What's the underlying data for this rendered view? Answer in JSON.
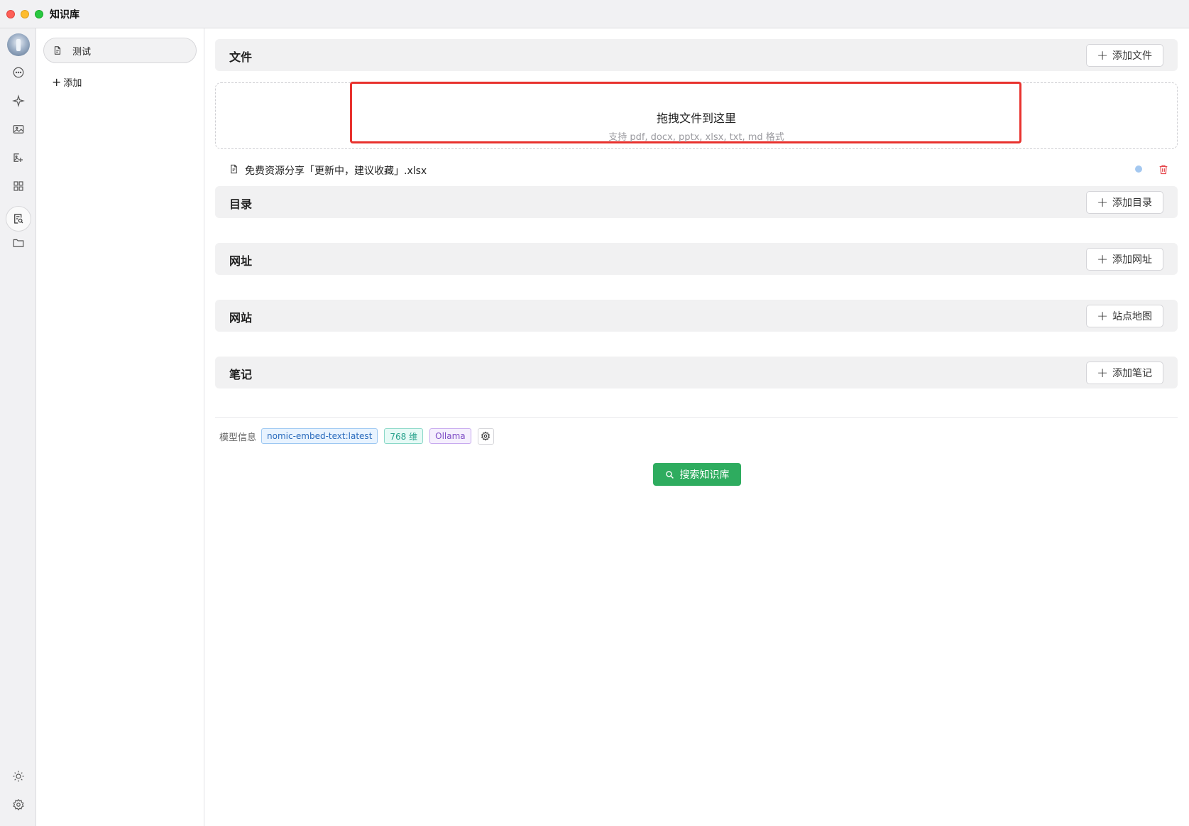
{
  "window": {
    "title": "知识库"
  },
  "rail": {
    "icons": [
      "avatar",
      "chat-icon",
      "sparkle-icon",
      "image-icon",
      "image-edit-icon",
      "apps-grid-icon",
      "knowledge-base-icon",
      "folder-icon",
      "sun-icon",
      "settings-icon"
    ],
    "active": "knowledge-base-icon"
  },
  "kb_list": {
    "items": [
      {
        "label": "测试"
      }
    ],
    "add_label": "添加"
  },
  "sections": {
    "files": {
      "title": "文件",
      "button": "添加文件"
    },
    "directory": {
      "title": "目录",
      "button": "添加目录"
    },
    "url": {
      "title": "网址",
      "button": "添加网址"
    },
    "website": {
      "title": "网站",
      "button": "站点地图"
    },
    "notes": {
      "title": "笔记",
      "button": "添加笔记"
    }
  },
  "dropzone": {
    "title": "拖拽文件到这里",
    "subtitle": "支持 pdf, docx, pptx, xlsx, txt, md 格式"
  },
  "files": [
    {
      "name": "免费资源分享「更新中，建议收藏」.xlsx",
      "status_color": "#a4c8f0"
    }
  ],
  "model_info": {
    "label": "模型信息",
    "model": "nomic-embed-text:latest",
    "dimensions": "768 维",
    "provider": "Ollama"
  },
  "search_button": "搜索知识库",
  "colors": {
    "accent_green": "#2eac5f",
    "highlight_red": "#e8322e",
    "delete_red": "#e5484d"
  }
}
